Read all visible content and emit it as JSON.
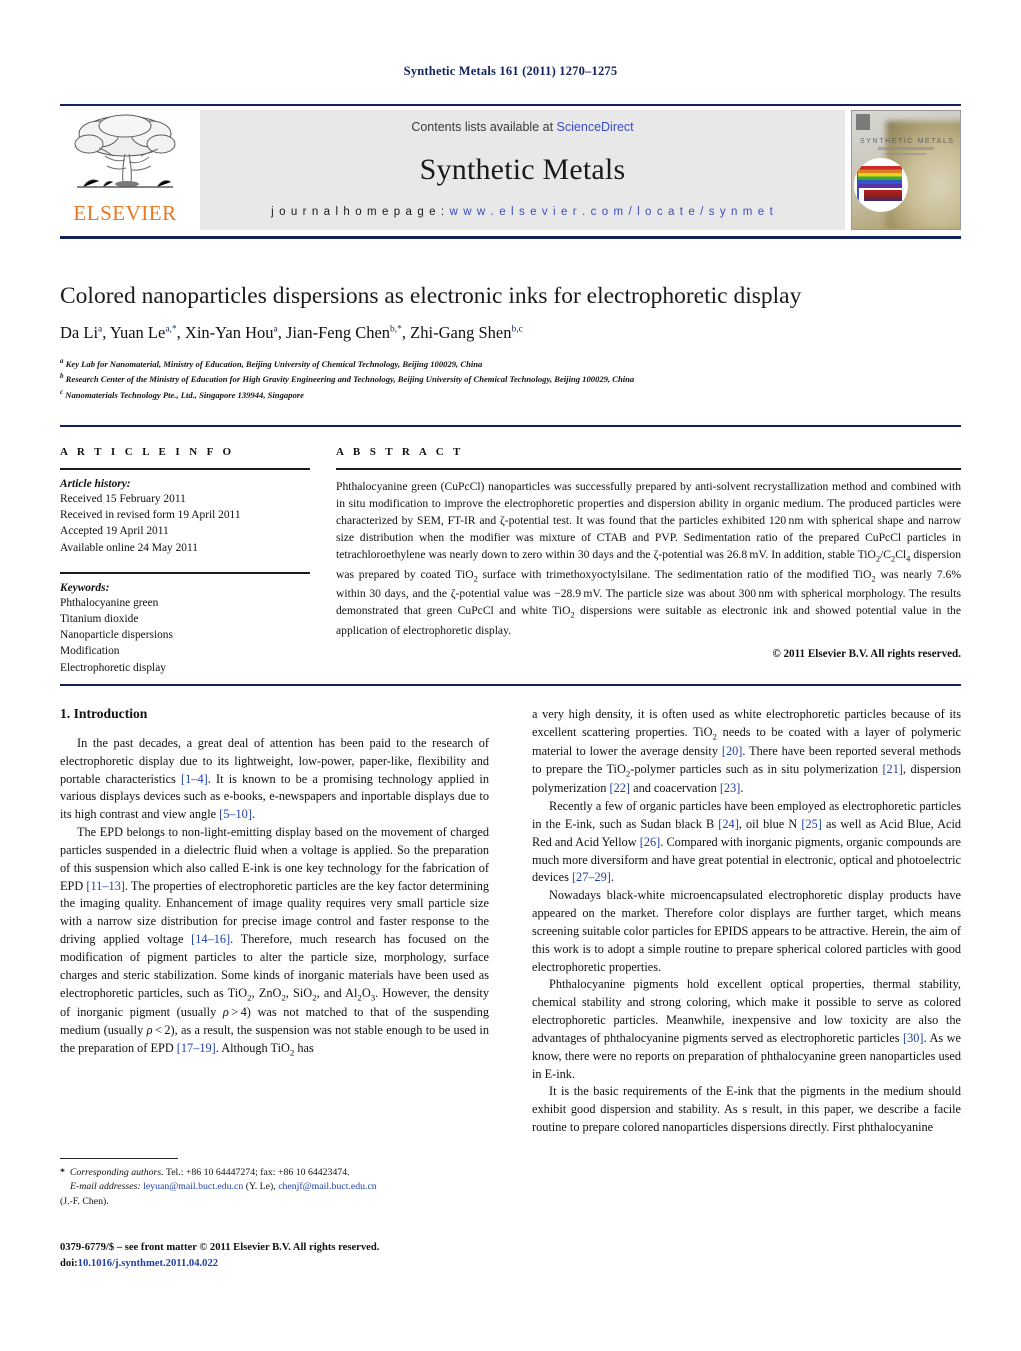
{
  "running_head": "Synthetic Metals 161 (2011) 1270–1275",
  "masthead": {
    "publisher_name": "ELSEVIER",
    "contents_prefix": "Contents lists available at",
    "contents_link": "ScienceDirect",
    "journal_title": "Synthetic Metals",
    "homepage_label": "j o u r n a l   h o m e p a g e :",
    "homepage_url": "w w w . e l s e v i e r . c o m / l o c a t e / s y n m e t",
    "cover_journal_name": "SYNTHETIC METALS",
    "link_color": "#3b4cc0",
    "brand_color": "#e87722",
    "rule_color": "#12235c"
  },
  "article": {
    "title": "Colored nanoparticles dispersions as electronic inks for electrophoretic display",
    "authors_html": "Da Li<sup>a</sup>, Yuan Le<sup>a,</sup><sup>*</sup>, Xin-Yan Hou<sup>a</sup>, Jian-Feng Chen<sup>b,</sup><sup>*</sup>, Zhi-Gang Shen<sup>b,c</sup>",
    "affiliations": [
      "Key Lab for Nanomaterial, Ministry of Education, Beijing University of Chemical Technology, Beijing 100029, China",
      "Research Center of the Ministry of Education for High Gravity Engineering and Technology, Beijing University of Chemical Technology, Beijing 100029, China",
      "Nanomaterials Technology Pte., Ltd., Singapore 139944, Singapore"
    ],
    "affiliation_marks": [
      "a",
      "b",
      "c"
    ]
  },
  "article_info": {
    "heading": "A R T I C L E   I N F O",
    "history_label": "Article history:",
    "history": [
      "Received 15 February 2011",
      "Received in revised form 19 April 2011",
      "Accepted 19 April 2011",
      "Available online 24 May 2011"
    ],
    "keywords_label": "Keywords:",
    "keywords": [
      "Phthalocyanine green",
      "Titanium dioxide",
      "Nanoparticle dispersions",
      "Modification",
      "Electrophoretic display"
    ]
  },
  "abstract": {
    "heading": "A B S T R A C T",
    "body_html": "Phthalocyanine green (CuPcCl) nanoparticles was successfully prepared by anti-solvent recrystallization method and combined with in situ modification to improve the electrophoretic properties and dispersion ability in organic medium. The produced particles were characterized by SEM, FT-IR and &#950;-potential test. It was found that the particles exhibited 120&#8239;nm with spherical shape and narrow size distribution when the modifier was mixture of CTAB and PVP. Sedimentation ratio of the prepared CuPcCl particles in tetrachloroethylene was nearly down to zero within 30 days and the &#950;-potential was 26.8&#8239;mV. In addition, stable TiO<sub>2</sub>/C<sub>2</sub>Cl<sub>4</sub> dispersion was prepared by coated TiO<sub>2</sub> surface with trimethoxyoctylsilane. The sedimentation ratio of the modified TiO<sub>2</sub> was nearly 7.6% within 30 days, and the &#950;-potential value was &#8722;28.9&#8239;mV. The particle size was about 300&#8239;nm with spherical morphology. The results demonstrated that green CuPcCl and white TiO<sub>2</sub> dispersions were suitable as electronic ink and showed potential value in the application of electrophoretic display.",
    "copyright": "© 2011 Elsevier B.V. All rights reserved."
  },
  "body": {
    "section_number_title": "1.  Introduction",
    "left_paragraphs_html": [
      "In the past decades, a great deal of attention has been paid to the research of electrophoretic display due to its lightweight, low-power, paper-like, flexibility and portable characteristics <span class=\"ref\">[1–4]</span>. It is known to be a promising technology applied in various displays devices such as e-books, e-newspapers and inportable displays due to its high contrast and view angle <span class=\"ref\">[5–10]</span>.",
      "The EPD belongs to non-light-emitting display based on the movement of charged particles suspended in a dielectric fluid when a voltage is applied. So the preparation of this suspension which also called E-ink is one key technology for the fabrication of EPD <span class=\"ref\">[11–13]</span>. The properties of electrophoretic particles are the key factor determining the imaging quality. Enhancement of image quality requires very small particle size with a narrow size distribution for precise image control and faster response to the driving applied voltage <span class=\"ref\">[14–16]</span>. Therefore, much research has focused on the modification of pigment particles to alter the particle size, morphology, surface charges and steric stabilization. Some kinds of inorganic materials have been used as electrophoretic particles, such as TiO<sub>2</sub>, ZnO<sub>2</sub>, SiO<sub>2</sub>, and Al<sub>2</sub>O<sub>3</sub>. However, the density of inorganic pigment (usually <i>&#961;</i>&#8239;&gt;&#8239;4) was not matched to that of the suspending medium (usually <i>&#961;</i>&#8239;&lt;&#8239;2), as a result, the suspension was not stable enough to be used in the preparation of EPD <span class=\"ref\">[17–19]</span>. Although TiO<sub>2</sub> has"
    ],
    "right_paragraphs_html": [
      "a very high density, it is often used as white electrophoretic particles because of its excellent scattering properties. TiO<sub>2</sub> needs to be coated with a layer of polymeric material to lower the average density <span class=\"ref\">[20]</span>. There have been reported several methods to prepare the TiO<sub>2</sub>-polymer particles such as in situ polymerization <span class=\"ref\">[21]</span>, dispersion polymerization <span class=\"ref\">[22]</span> and coacervation <span class=\"ref\">[23]</span>.",
      "Recently a few of organic particles have been employed as electrophoretic particles in the E-ink, such as Sudan black B <span class=\"ref\">[24]</span>, oil blue N <span class=\"ref\">[25]</span> as well as Acid Blue, Acid Red and Acid Yellow <span class=\"ref\">[26]</span>. Compared with inorganic pigments, organic compounds are much more diversiform and have great potential in electronic, optical and photoelectric devices <span class=\"ref\">[27–29]</span>.",
      "Nowadays black-white microencapsulated electrophoretic display products have appeared on the market. Therefore color displays are further target, which means screening suitable color particles for EPIDS appears to be attractive. Herein, the aim of this work is to adopt a simple routine to prepare spherical colored particles with good electrophoretic properties.",
      "Phthalocyanine pigments hold excellent optical properties, thermal stability, chemical stability and strong coloring, which make it possible to serve as colored electrophoretic particles. Meanwhile, inexpensive and low toxicity are also the advantages of phthalocyanine pigments served as electrophoretic particles <span class=\"ref\">[30]</span>. As we know, there were no reports on preparation of phthalocyanine green nanoparticles used in E-ink.",
      "It is the basic requirements of the E-ink that the pigments in the medium should exhibit good dispersion and stability. As s result, in this paper, we describe a facile routine to prepare colored nanoparticles dispersions directly. First phthalocyanine"
    ]
  },
  "footnote": {
    "corresponding_html": "<b>*</b>&nbsp; <span class=\"ital\">Corresponding authors.</span> Tel.: +86 10 64447274; fax: +86 10 64423474.",
    "emails_html": "<span class=\"ital\">E-mail addresses:</span> <span class=\"lnk\">leyuan@mail.buct.edu.cn</span> (Y. Le), <span class=\"lnk\">chenjf@mail.buct.edu.cn</span>",
    "emails_cont": "(J.-F. Chen).",
    "front_matter": "0379-6779/$ – see front matter © 2011 Elsevier B.V. All rights reserved.",
    "doi_label": "doi:",
    "doi_value": "10.1016/j.synthmet.2011.04.022"
  }
}
